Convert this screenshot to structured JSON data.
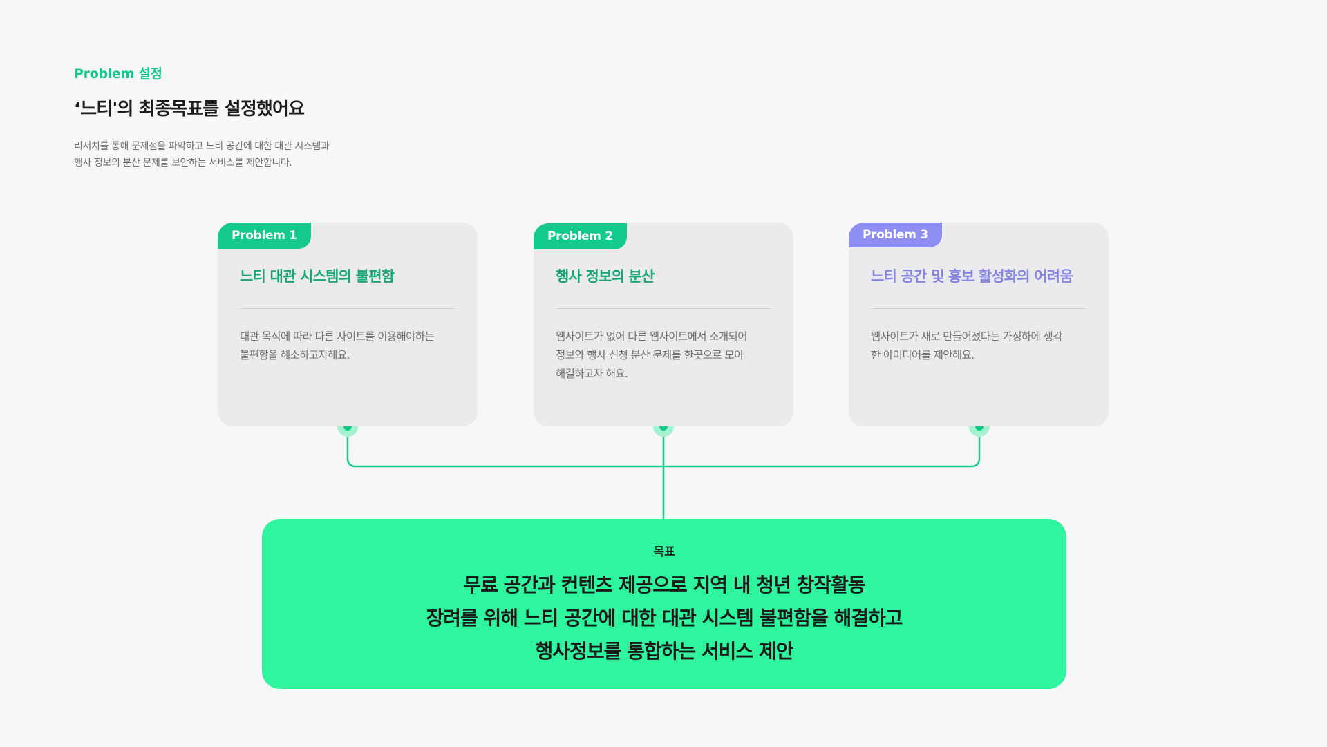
{
  "colors": {
    "background": "#f7f7f7",
    "accent_green": "#13c98c",
    "accent_purple": "#8f8ff3",
    "goal_background": "#2ff69e",
    "card_background": "#ebebed"
  },
  "header": {
    "eyebrow": "Problem 설정",
    "title": "‘느티'의 최종목표를 설정했어요",
    "description": [
      "리서치를 통해 문제점을 파악하고 느티 공간에 대한 대관 시스템과",
      "행사 정보의 분산 문제를 보안하는 서비스를 제안합니다."
    ]
  },
  "problems": [
    {
      "tab": "Problem 1",
      "title": "느티 대관 시스템의 불편함",
      "lines": [
        "대관 목적에 따라 다른 사이트를 이용해야하는",
        "불편함을 해소하고자해요."
      ],
      "color": "#13c98c",
      "title_color": "#15a778"
    },
    {
      "tab": "Problem 2",
      "title": "행사 정보의 분산",
      "lines": [
        "웹사이트가 없어 다른 웹사이트에서 소개되어",
        "정보와 행사 신청 분산 문제를 한곳으로 모아",
        "해결하고자 해요."
      ],
      "color": "#13c98c",
      "title_color": "#15a778"
    },
    {
      "tab": "Problem 3",
      "title": "느티 공간 및 홍보 활성화의 어려움",
      "lines": [
        "웹사이트가 새로 만들어졌다는 가정하에 생각",
        "한 아이디어를 제안해요."
      ],
      "color": "#8f8ff3",
      "title_color": "#8585e6"
    }
  ],
  "goal": {
    "label": "목표",
    "lines": [
      "무료 공간과 컨텐츠 제공으로 지역 내 청년 창작활동",
      "장려를 위해 느티 공간에 대한 대관 시스템 불편함을 해결하고",
      "행사정보를 통합하는 서비스 제안"
    ]
  }
}
